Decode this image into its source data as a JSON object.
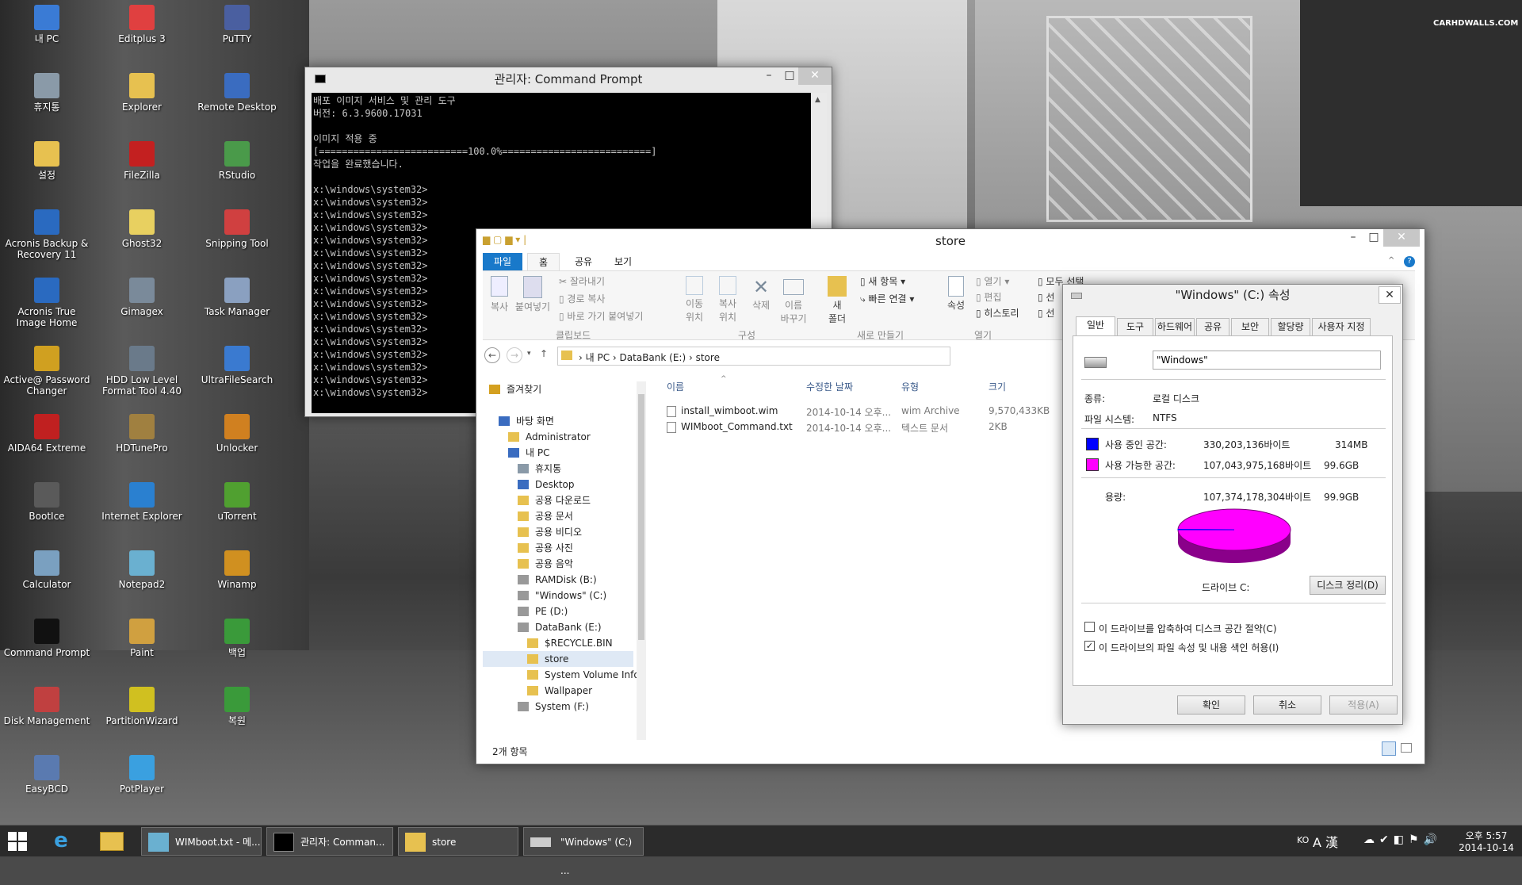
{
  "desktop": {
    "watermark": "CARHDWALLS.COM",
    "icons": [
      {
        "label": "내 PC",
        "icon": "monitor-icon",
        "color": "#3a7bd5"
      },
      {
        "label": "Editplus 3",
        "icon": "editplus-icon",
        "color": "#e04040"
      },
      {
        "label": "PuTTY",
        "icon": "putty-icon",
        "color": "#4a5fa0"
      },
      {
        "label": "휴지통",
        "icon": "recycle-bin-icon",
        "color": "#8a9aa8"
      },
      {
        "label": "Explorer",
        "icon": "folder-icon",
        "color": "#e7c150"
      },
      {
        "label": "Remote Desktop",
        "icon": "remote-desktop-icon",
        "color": "#3a6cc0"
      },
      {
        "label": "설정",
        "icon": "folder-icon",
        "color": "#e7c150"
      },
      {
        "label": "FileZilla",
        "icon": "filezilla-icon",
        "color": "#c32020"
      },
      {
        "label": "RStudio",
        "icon": "rstudio-icon",
        "color": "#4a9a4a"
      },
      {
        "label": "Acronis Backup & Recovery 11",
        "icon": "acronis-icon",
        "color": "#2a6ac0"
      },
      {
        "label": "Ghost32",
        "icon": "ghost-icon",
        "color": "#e8d060"
      },
      {
        "label": "Snipping Tool",
        "icon": "scissors-icon",
        "color": "#d04040"
      },
      {
        "label": "Acronis True Image Home",
        "icon": "acronis-icon",
        "color": "#2a6ac0"
      },
      {
        "label": "Gimagex",
        "icon": "gimagex-icon",
        "color": "#7a8a9a"
      },
      {
        "label": "Task Manager",
        "icon": "task-manager-icon",
        "color": "#8aa0c0"
      },
      {
        "label": "Active@ Password Changer",
        "icon": "key-icon",
        "color": "#d0a020"
      },
      {
        "label": "HDD Low Level Format Tool 4.40",
        "icon": "hdd-icon",
        "color": "#6a7a8a"
      },
      {
        "label": "UltraFileSearch",
        "icon": "magnifier-icon",
        "color": "#3a7ad0"
      },
      {
        "label": "AIDA64 Extreme",
        "icon": "aida64-icon",
        "color": "#c02020"
      },
      {
        "label": "HDTunePro",
        "icon": "hdtune-icon",
        "color": "#a08040"
      },
      {
        "label": "Unlocker",
        "icon": "unlocker-icon",
        "color": "#d08020"
      },
      {
        "label": "BootIce",
        "icon": "bootice-icon",
        "color": "#5a5a5a"
      },
      {
        "label": "Internet Explorer",
        "icon": "ie-icon",
        "color": "#2a80d0"
      },
      {
        "label": "uTorrent",
        "icon": "utorrent-icon",
        "color": "#50a030"
      },
      {
        "label": "Calculator",
        "icon": "calculator-icon",
        "color": "#7aa0c0"
      },
      {
        "label": "Notepad2",
        "icon": "notepad-icon",
        "color": "#6ab0d0"
      },
      {
        "label": "Winamp",
        "icon": "winamp-icon",
        "color": "#d09020"
      },
      {
        "label": "Command Prompt",
        "icon": "cmd-icon",
        "color": "#111111"
      },
      {
        "label": "Paint",
        "icon": "paint-icon",
        "color": "#d0a040"
      },
      {
        "label": "백업",
        "icon": "backup-icon",
        "color": "#3a9a3a"
      },
      {
        "label": "Disk Management",
        "icon": "disk-management-icon",
        "color": "#c04040"
      },
      {
        "label": "PartitionWizard",
        "icon": "partition-icon",
        "color": "#d0c020"
      },
      {
        "label": "복원",
        "icon": "restore-icon",
        "color": "#3a9a3a"
      },
      {
        "label": "EasyBCD",
        "icon": "easybcd-icon",
        "color": "#5a7ab0"
      },
      {
        "label": "PotPlayer",
        "icon": "play-icon",
        "color": "#3aa0e0"
      }
    ]
  },
  "cmd": {
    "title": "관리자: Command Prompt",
    "lines": [
      "배포 이미지 서비스 및 관리 도구",
      "버전: 6.3.9600.17031",
      "",
      "이미지 적용 중",
      "[==========================100.0%==========================]",
      "작업을 완료했습니다.",
      "",
      "x:\\windows\\system32>",
      "x:\\windows\\system32>",
      "x:\\windows\\system32>",
      "x:\\windows\\system32>",
      "x:\\windows\\system32>",
      "x:\\windows\\system32>",
      "x:\\windows\\system32>",
      "x:\\windows\\system32>",
      "x:\\windows\\system32>",
      "x:\\windows\\system32>",
      "x:\\windows\\system32>",
      "x:\\windows\\system32>",
      "x:\\windows\\system32>",
      "x:\\windows\\system32>",
      "x:\\windows\\system32>",
      "x:\\windows\\system32>",
      "x:\\windows\\system32>"
    ]
  },
  "explorer": {
    "title": "store",
    "tabs": [
      "파일",
      "홈",
      "공유",
      "보기"
    ],
    "ribbon": {
      "copy": "복사",
      "paste": "붙여넣기",
      "cut": "잘라내기",
      "copy_path": "경로 복사",
      "paste_shortcut": "바로 가기 붙여넣기",
      "clipboard_group": "클립보드",
      "move_to": "이동\n위치",
      "copy_to": "복사\n위치",
      "delete": "삭제",
      "rename": "이름\n바꾸기",
      "organize_group": "구성",
      "new_folder": "새\n폴더",
      "new_item": "새 항목",
      "easy_access": "빠른 연결",
      "new_group": "새로 만들기",
      "properties": "속성",
      "open": "열기",
      "edit": "편집",
      "history": "히스토리",
      "open_group": "열기",
      "select_all": "모두 선택",
      "select_none": "선",
      "invert": "선"
    },
    "path": [
      "내 PC",
      "DataBank (E:)",
      "store"
    ],
    "columns": [
      "이름",
      "수정한 날짜",
      "유형",
      "크기"
    ],
    "files": [
      {
        "name": "install_wimboot.wim",
        "date": "2014-10-14 오후...",
        "type": "wim Archive",
        "size": "9,570,433KB"
      },
      {
        "name": "WIMboot_Command.txt",
        "date": "2014-10-14 오후...",
        "type": "텍스트 문서",
        "size": "2KB"
      }
    ],
    "tree": [
      "즐겨찾기",
      "바탕 화면",
      "Administrator",
      "내 PC",
      "휴지통",
      "Desktop",
      "공용 다운로드",
      "공용 문서",
      "공용 비디오",
      "공용 사진",
      "공용 음악",
      "RAMDisk (B:)",
      "\"Windows\" (C:)",
      "PE (D:)",
      "DataBank (E:)",
      "$RECYCLE.BIN",
      "store",
      "System Volume Inform",
      "Wallpaper",
      "System (F:)"
    ],
    "status": "2개 항목"
  },
  "props": {
    "title": "\"Windows\" (C:) 속성",
    "tabs": [
      "일반",
      "도구",
      "하드웨어",
      "공유",
      "보안",
      "할당량",
      "사용자 지정"
    ],
    "name_value": "\"Windows\"",
    "type_label": "종류:",
    "type_value": "로컬 디스크",
    "fs_label": "파일 시스템:",
    "fs_value": "NTFS",
    "used_label": "사용 중인 공간:",
    "used_bytes": "330,203,136바이트",
    "used_short": "314MB",
    "free_label": "사용 가능한 공간:",
    "free_bytes": "107,043,975,168바이트",
    "free_short": "99.6GB",
    "cap_label": "용량:",
    "cap_bytes": "107,374,178,304바이트",
    "cap_short": "99.9GB",
    "drive_label": "드라이브 C:",
    "cleanup": "디스크 정리(D)",
    "compress": "이 드라이브를 압축하여 디스크 공간 절약(C)",
    "index": "이 드라이브의 파일 속성 및 내용 색인 허용(I)",
    "ok": "확인",
    "cancel": "취소",
    "apply": "적용(A)",
    "used_color": "#0000ff",
    "free_color": "#ff00ff",
    "used_fraction": 0.0031
  },
  "taskbar": {
    "buttons": [
      "WIMboot.txt - 메...",
      "관리자: Comman...",
      "store",
      "\"Windows\" (C:) ..."
    ],
    "lang": "KO",
    "time": "오후 5:57",
    "date": "2014-10-14"
  }
}
